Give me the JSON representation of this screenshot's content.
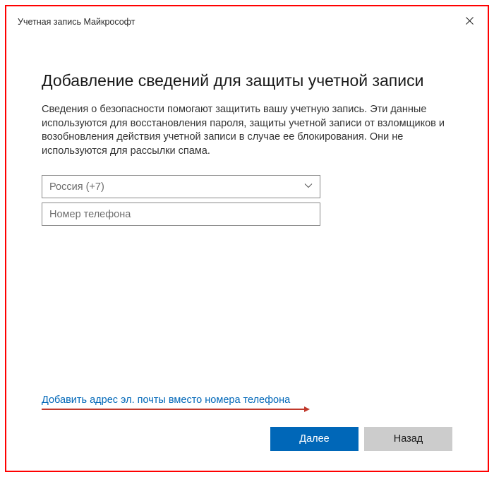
{
  "titlebar": {
    "title": "Учетная запись Майкрософт"
  },
  "main": {
    "heading": "Добавление сведений для защиты учетной записи",
    "description": "Сведения о безопасности помогают защитить вашу учетную запись. Эти данные используются для восстановления пароля, защиты учетной записи от взломщиков и возобновления действия учетной записи в случае ее блокирования. Они не используются для рассылки спама."
  },
  "form": {
    "country_selected": "Россия (+7)",
    "phone_placeholder": "Номер телефона",
    "phone_value": ""
  },
  "link": {
    "email_instead": "Добавить адрес эл. почты вместо номера телефона"
  },
  "buttons": {
    "next": "Далее",
    "back": "Назад"
  }
}
